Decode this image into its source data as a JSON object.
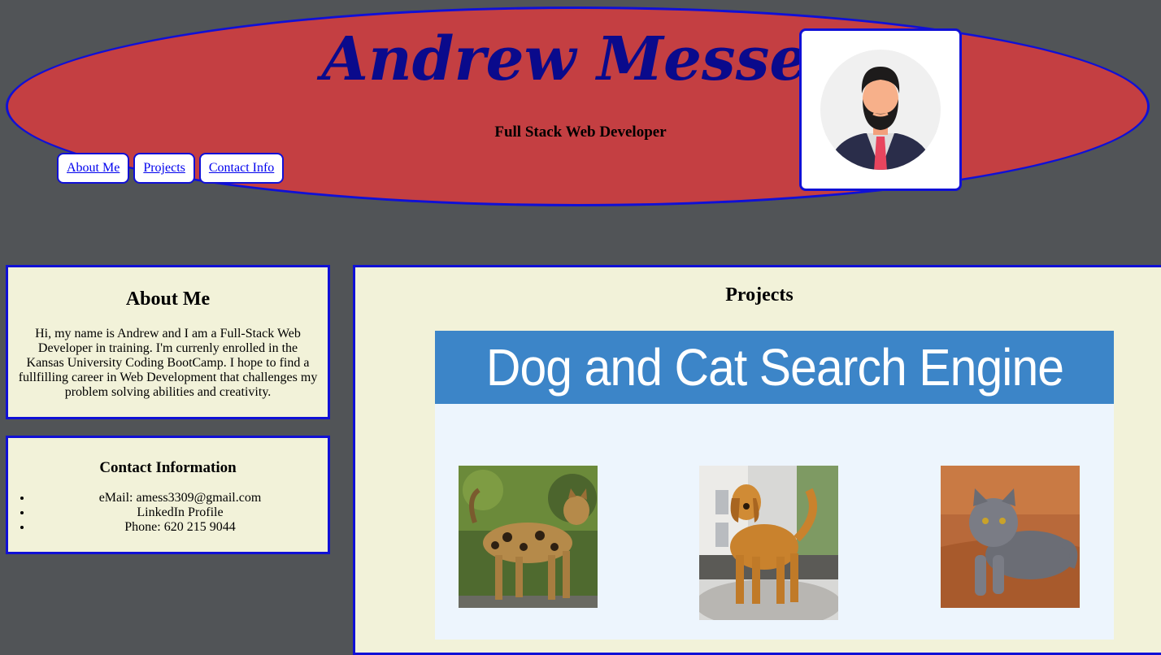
{
  "header": {
    "name": "Andrew Messer",
    "subtitle": "Full Stack Web Developer",
    "nav": [
      {
        "label": "About Me"
      },
      {
        "label": "Projects"
      },
      {
        "label": "Contact Info"
      }
    ]
  },
  "about": {
    "title": "About Me",
    "text": "Hi, my name is Andrew and I am a Full-Stack Web Developer in training. I'm currenly enrolled in the Kansas University Coding BootCamp. I hope to find a fullfilling career in Web Development that challenges my problem solving abilities and creativity."
  },
  "contact": {
    "title": "Contact Information",
    "items": [
      "eMail: amess3309@gmail.com",
      "LinkedIn Profile",
      "Phone: 620 215 9044"
    ]
  },
  "projects": {
    "title": "Projects",
    "featured": {
      "banner": "Dog and Cat Search Engine"
    }
  },
  "colors": {
    "page_bg": "#515457",
    "header_bg": "#c43f42",
    "border": "#1010d6",
    "card_bg": "#f2f2d9",
    "title": "#0a0a8c",
    "banner_bg": "#3c85c8"
  }
}
